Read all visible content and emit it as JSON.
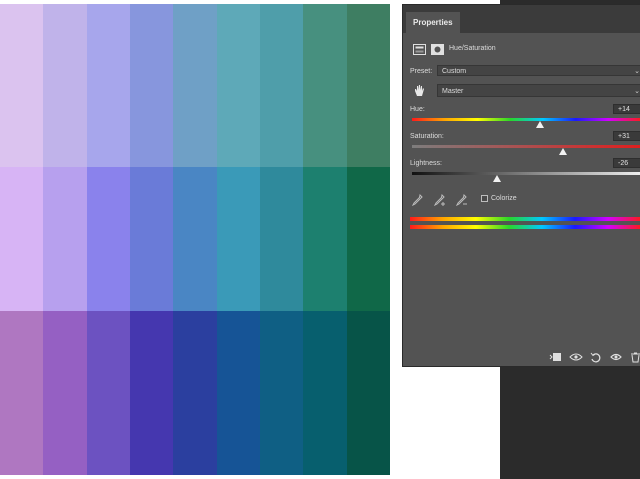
{
  "canvas": {
    "swatch_colors": [
      [
        "#dbc3ef",
        "#c0b3ea",
        "#a7a6ec",
        "#8796dd",
        "#6fa0c6",
        "#5ea9b8",
        "#4f9eaa",
        "#47907f",
        "#3e7e62"
      ],
      [
        "#d7b4f5",
        "#b7a0ee",
        "#8a82ec",
        "#6a7bd8",
        "#4a86c4",
        "#3a9ab8",
        "#2f8a9c",
        "#1d806f",
        "#106848"
      ],
      [
        "#af77c1",
        "#9560c3",
        "#6c52c1",
        "#4537af",
        "#2b3f9f",
        "#165496",
        "#0f5f84",
        "#075f6e",
        "#075448"
      ]
    ]
  },
  "properties_panel": {
    "tab_label": "Properties",
    "adjustment_title": "Hue/Saturation",
    "preset": {
      "label": "Preset:",
      "value": "Custom"
    },
    "channel": {
      "value": "Master"
    },
    "hue": {
      "label": "Hue:",
      "value": "+14",
      "level": 0.56
    },
    "saturation": {
      "label": "Saturation:",
      "value": "+31",
      "level": 0.66
    },
    "lightness": {
      "label": "Lightness:",
      "value": "-26",
      "level": 0.37
    },
    "colorize": {
      "label": "Colorize",
      "checked": false
    },
    "icons": {
      "adjustment": "hue-saturation-icon",
      "mask": "layer-mask-icon",
      "hand": "on-image-adjust-icon",
      "eyedropper": "eyedropper-icon",
      "eyedropper_add": "eyedropper-add-icon",
      "eyedropper_subtract": "eyedropper-subtract-icon",
      "clip": "clip-to-layer-icon",
      "view_previous": "view-previous-state-icon",
      "reset": "reset-icon",
      "visibility": "visibility-icon",
      "delete": "trash-icon"
    },
    "colors": {
      "panel_bg": "#535353",
      "tabbar_bg": "#3b3b3b",
      "hue_track": "linear-gradient(90deg,#ff1a1a,#ffa500,#ffff00,#29d629,#00c8ff,#1a1aff,#d200ff,#ff1a1a)",
      "saturation_track": "linear-gradient(90deg,#7d7d7d,#e01e1e)",
      "lightness_track": "linear-gradient(90deg,#111111,#f0f0f0)",
      "spectrum": "linear-gradient(90deg,#ff1a1a,#ffa500,#ffff00,#29d629,#00c8ff,#1a1aff,#d200ff,#ff1a1a)"
    }
  }
}
